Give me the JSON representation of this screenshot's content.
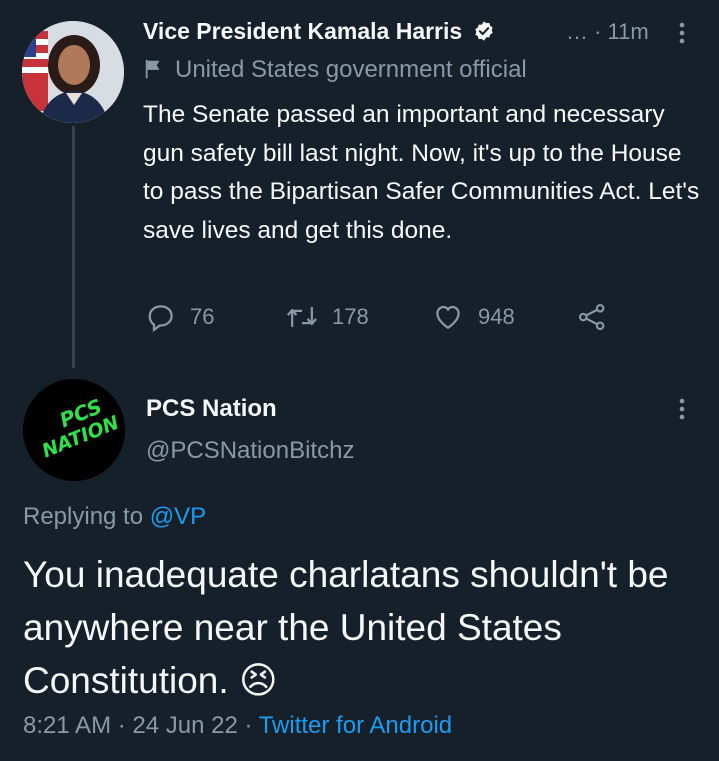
{
  "parent_tweet": {
    "author_name": "Vice President Kamala Harris",
    "time_meta": "… · 11m",
    "label": "United States government official",
    "text": "The Senate passed an important and necessary gun safety bill last night. Now, it's up to the House to pass the Bipartisan Safer Communities Act. Let's save lives and get this done.",
    "counts": {
      "replies": "76",
      "retweets": "178",
      "likes": "948"
    },
    "icons": [
      "reply-icon",
      "retweet-icon",
      "like-icon",
      "share-icon",
      "verified-badge-icon",
      "flag-icon",
      "more-icon"
    ]
  },
  "reply_tweet": {
    "author_name": "PCS Nation",
    "handle": "@PCSNationBitchz",
    "avatar_text": "PCS NATION",
    "replying_prefix": "Replying to",
    "replying_to": "@VP",
    "text": "You inadequate charlatans shouldn't be anywhere near the United States Constitution. 😣",
    "timestamp": "8:21 AM · 24 Jun 22 · ",
    "source": "Twitter for Android"
  },
  "colors": {
    "background": "#15202b",
    "text": "#f7f9f9",
    "muted": "#8b98a5",
    "link": "#1d9bf0",
    "pcs_avatar_text": "#2ee04a"
  }
}
